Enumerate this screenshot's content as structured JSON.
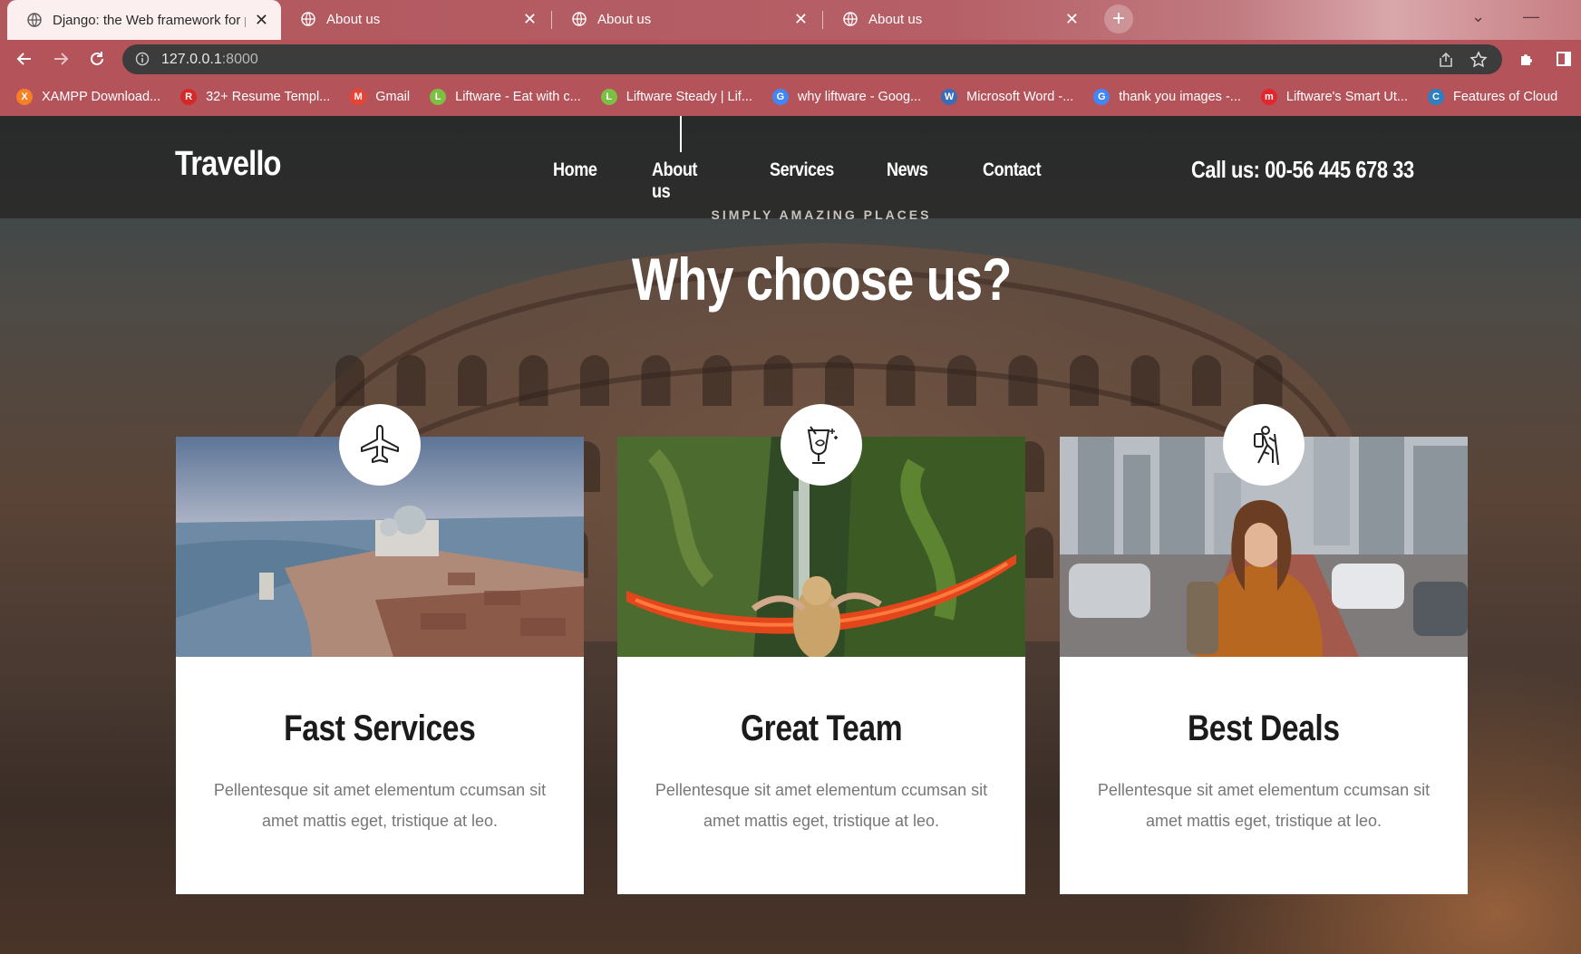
{
  "browser": {
    "tabs": [
      {
        "title": "Django: the Web framework for p",
        "active": true
      },
      {
        "title": "About us",
        "active": false
      },
      {
        "title": "About us",
        "active": false
      },
      {
        "title": "About us",
        "active": false
      }
    ],
    "url": {
      "host": "127.0.0.1",
      "port": ":8000"
    },
    "bookmarks": [
      {
        "label": "XAMPP Download...",
        "icon": "xampp-icon",
        "color": "#f58025",
        "glyph": "X"
      },
      {
        "label": "32+ Resume Templ...",
        "icon": "resume-icon",
        "color": "#d62828",
        "glyph": "R"
      },
      {
        "label": "Gmail",
        "icon": "gmail-icon",
        "color": "#ea4335",
        "glyph": "M"
      },
      {
        "label": "Liftware - Eat with c...",
        "icon": "liftware-icon",
        "color": "#7bc043",
        "glyph": "L"
      },
      {
        "label": "Liftware Steady | Lif...",
        "icon": "liftware-icon",
        "color": "#7bc043",
        "glyph": "L"
      },
      {
        "label": "why liftware - Goog...",
        "icon": "google-icon",
        "color": "#4285f4",
        "glyph": "G"
      },
      {
        "label": "Microsoft Word -...",
        "icon": "wordpress-icon",
        "color": "#3a6db5",
        "glyph": "W"
      },
      {
        "label": "thank you images -...",
        "icon": "google-icon",
        "color": "#4285f4",
        "glyph": "G"
      },
      {
        "label": "Liftware's Smart Ut...",
        "icon": "m-icon",
        "color": "#e3262e",
        "glyph": "m"
      },
      {
        "label": "Features of Cloud",
        "icon": "cloud-icon",
        "color": "#2d7fc1",
        "glyph": "C"
      }
    ]
  },
  "site": {
    "logo": "Travello",
    "nav": [
      "Home",
      "About us",
      "Services",
      "News",
      "Contact"
    ],
    "callus": "Call us: 00-56 445 678 33",
    "eyebrow": "SIMPLY AMAZING PLACES",
    "headline": "Why choose us?"
  },
  "cards": [
    {
      "title": "Fast Services",
      "text": "Pellentesque sit amet elementum ccumsan sit amet mattis eget, tristique at leo.",
      "icon": "airplane-icon"
    },
    {
      "title": "Great Team",
      "text": "Pellentesque sit amet elementum ccumsan sit amet mattis eget, tristique at leo.",
      "icon": "cocktail-icon"
    },
    {
      "title": "Best Deals",
      "text": "Pellentesque sit amet elementum ccumsan sit amet mattis eget, tristique at leo.",
      "icon": "hiker-icon"
    }
  ]
}
